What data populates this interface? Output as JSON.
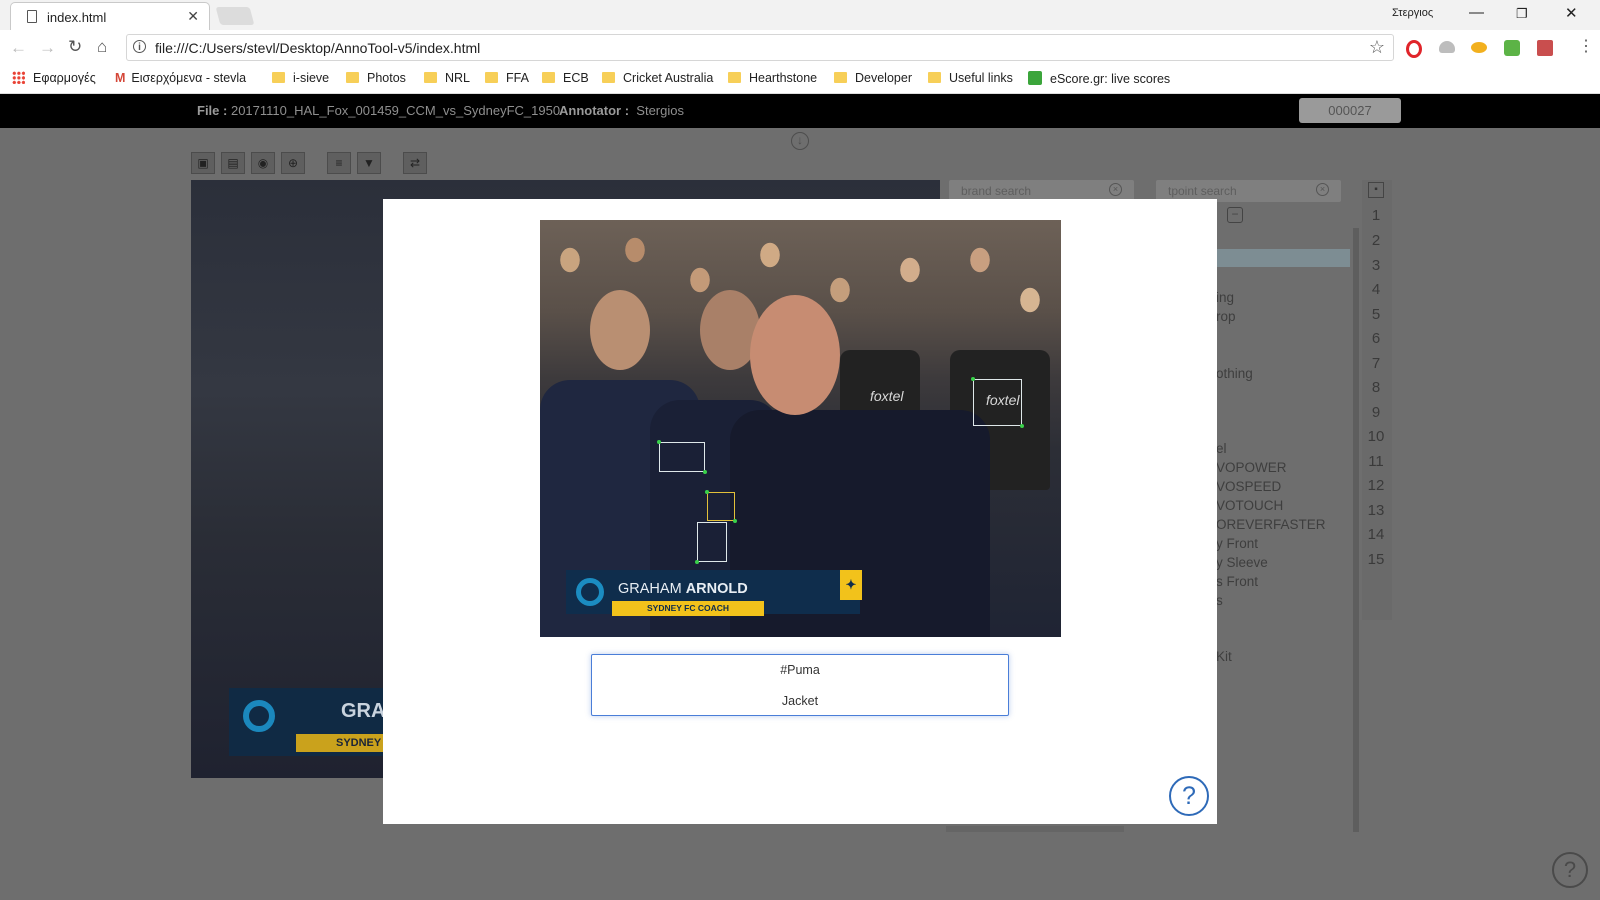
{
  "browser": {
    "tab_title": "index.html",
    "profile": "Στεργιος",
    "url": "file:///C:/Users/stevl/Desktop/AnnoTool-v5/index.html",
    "bookmarks": [
      "Εφαρμογές",
      "Εισερχόμενα - stevla",
      "i-sieve",
      "Photos",
      "NRL",
      "FFA",
      "ECB",
      "Cricket Australia",
      "Hearthstone",
      "Developer",
      "Useful links",
      "eScore.gr: live scores"
    ]
  },
  "app": {
    "file_label": "File :",
    "file_name": "20171110_HAL_Fox_001459_CCM_vs_SydneyFC_1950",
    "annotator_label": "Annotator :",
    "annotator": "Stergios",
    "frame_id": "000027",
    "brand_search_placeholder": "brand search",
    "tpoint_search_placeholder": "tpoint search",
    "list_fragments": [
      "ing",
      "rop",
      "othing",
      "el",
      "VOPOWER",
      "VOSPEED",
      "VOTOUCH",
      "OREVERFASTER",
      "y Front",
      "y Sleeve",
      "s Front",
      "s",
      "Kit"
    ],
    "numbers": [
      "1",
      "2",
      "3",
      "4",
      "5",
      "6",
      "7",
      "8",
      "9",
      "10",
      "11",
      "12",
      "13",
      "14",
      "15"
    ],
    "help": "?"
  },
  "modal": {
    "lower_third_first": "GRAHAM",
    "lower_third_last": "ARNOLD",
    "lower_third_role": "SYDNEY FC COACH",
    "bg_lower_third_name": "GRAHAM",
    "bg_lower_third_role": "SYDNEY F",
    "seat_logo": "foxtel",
    "brand": "#Puma",
    "tpoint": "Jacket",
    "help": "?"
  }
}
